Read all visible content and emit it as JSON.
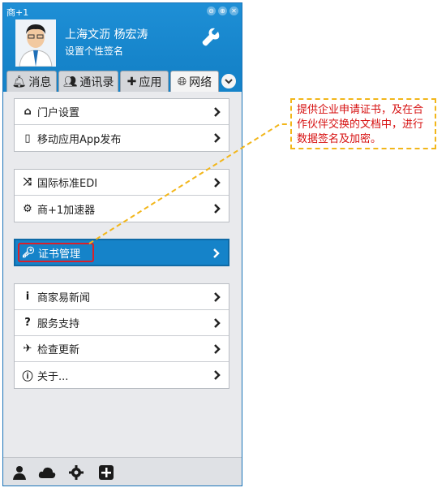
{
  "app": {
    "title": "商+1",
    "window_buttons": [
      "⊖",
      "⊕",
      "✕"
    ]
  },
  "user": {
    "name": "上海文沥 杨宏涛",
    "signature": "设置个性签名",
    "avatar_icon": "user-avatar",
    "settings_icon": "wrench-icon"
  },
  "tabs": [
    {
      "label": "消息",
      "icon": "bell-icon"
    },
    {
      "label": "通讯录",
      "icon": "contacts-icon"
    },
    {
      "label": "应用",
      "icon": "puzzle-icon"
    },
    {
      "label": "网络",
      "icon": "globe-icon",
      "active": true
    }
  ],
  "groups": [
    {
      "items": [
        {
          "label": "门户设置",
          "icon": "home-icon"
        },
        {
          "label": "移动应用App发布",
          "icon": "mobile-icon"
        }
      ]
    },
    {
      "items": [
        {
          "label": "国际标准EDI",
          "icon": "shuffle-icon"
        },
        {
          "label": "商+1加速器",
          "icon": "gears-icon"
        }
      ]
    },
    {
      "items": [
        {
          "label": "证书管理",
          "icon": "key-icon",
          "selected": true
        }
      ]
    },
    {
      "items": [
        {
          "label": "商家易新闻",
          "icon": "info-i-icon"
        },
        {
          "label": "服务支持",
          "icon": "question-icon"
        },
        {
          "label": "检查更新",
          "icon": "plane-icon"
        },
        {
          "label": "关于...",
          "icon": "info-circle-icon"
        }
      ]
    }
  ],
  "bottom_bar": [
    "user-icon",
    "cloud-icon",
    "gear-icon",
    "plus-square-icon"
  ],
  "callout": {
    "text": "提供企业申请证书，及在合作伙伴交换的文档中，进行数据签名及加密。"
  },
  "colors": {
    "header_blue": "#1583c9",
    "callout_border": "#f2b61a",
    "callout_text": "#d60f0f",
    "highlight_red": "#d9202a"
  }
}
